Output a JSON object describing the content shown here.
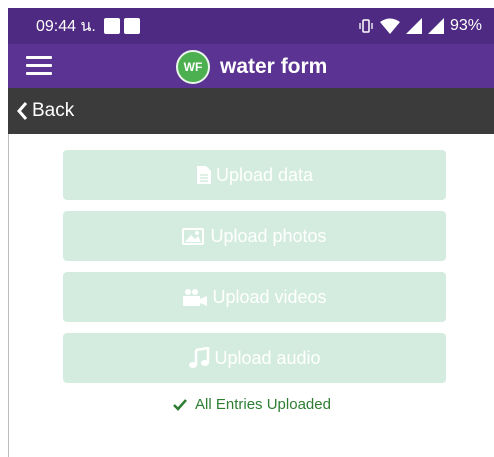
{
  "status_bar": {
    "time": "09:44 น.",
    "battery": "93%"
  },
  "app_bar": {
    "logo_text": "WF",
    "title": "water form"
  },
  "nav": {
    "back_label": "Back"
  },
  "uploads": {
    "data_label": "Upload data",
    "photos_label": "Upload photos",
    "videos_label": "Upload videos",
    "audio_label": "Upload audio"
  },
  "status_message": "All Entries Uploaded",
  "colors": {
    "status_bar": "#4e2a82",
    "app_bar": "#5b3493",
    "back_bar": "#3b3b3b",
    "upload_button_bg": "#d4ecdf",
    "success": "#2e7d32",
    "logo_green": "#4caf50"
  },
  "icons": [
    "menu-icon",
    "back-chevron-icon",
    "file-icon",
    "image-icon",
    "video-camera-icon",
    "music-note-icon",
    "checkmark-icon",
    "vibrate-icon",
    "wifi-icon",
    "signal-icon"
  ]
}
